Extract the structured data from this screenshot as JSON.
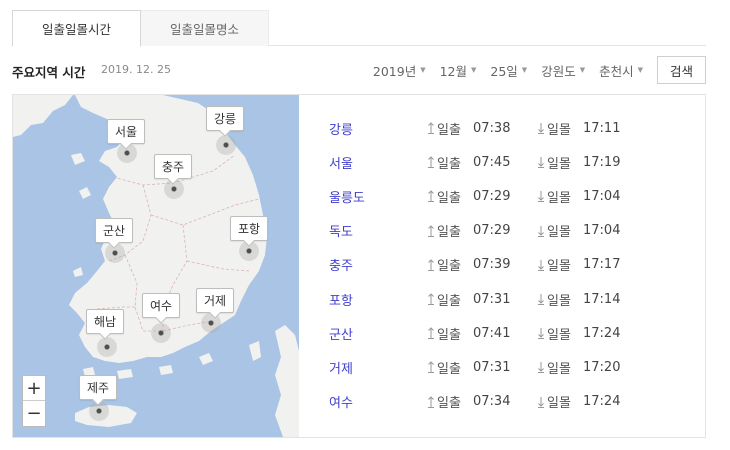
{
  "tabs": [
    {
      "label": "일출일몰시간",
      "active": true
    },
    {
      "label": "일출일몰명소",
      "active": false
    }
  ],
  "section": {
    "title": "주요지역 시간",
    "date": "2019. 12. 25"
  },
  "filters": {
    "year": "2019년",
    "month": "12월",
    "day": "25일",
    "province": "강원도",
    "city": "춘천시",
    "search_label": "검색"
  },
  "map": {
    "labels": {
      "gangneung": "강릉",
      "seoul": "서울",
      "chungju": "충주",
      "gunsan": "군산",
      "pohang": "포항",
      "yeosu": "여수",
      "geoje": "거제",
      "haenam": "해남",
      "jeju": "제주"
    },
    "zoom_in": "+",
    "zoom_out": "−"
  },
  "times": [
    {
      "city": "강릉",
      "rise_label": "일출",
      "rise": "07:38",
      "set_label": "일몰",
      "set": "17:11"
    },
    {
      "city": "서울",
      "rise_label": "일출",
      "rise": "07:45",
      "set_label": "일몰",
      "set": "17:19"
    },
    {
      "city": "울릉도",
      "rise_label": "일출",
      "rise": "07:29",
      "set_label": "일몰",
      "set": "17:04"
    },
    {
      "city": "독도",
      "rise_label": "일출",
      "rise": "07:29",
      "set_label": "일몰",
      "set": "17:04"
    },
    {
      "city": "충주",
      "rise_label": "일출",
      "rise": "07:39",
      "set_label": "일몰",
      "set": "17:17"
    },
    {
      "city": "포항",
      "rise_label": "일출",
      "rise": "07:31",
      "set_label": "일몰",
      "set": "17:14"
    },
    {
      "city": "군산",
      "rise_label": "일출",
      "rise": "07:41",
      "set_label": "일몰",
      "set": "17:24"
    },
    {
      "city": "거제",
      "rise_label": "일출",
      "rise": "07:31",
      "set_label": "일몰",
      "set": "17:20"
    },
    {
      "city": "여수",
      "rise_label": "일출",
      "rise": "07:34",
      "set_label": "일몰",
      "set": "17:24"
    }
  ],
  "icons": {
    "sunrise": "sunrise-arrow-icon",
    "sunset": "sunset-arrow-icon"
  },
  "colors": {
    "city_link": "#3f3fcf",
    "sea": "#a9c4e4",
    "land": "#f1f1ef"
  }
}
